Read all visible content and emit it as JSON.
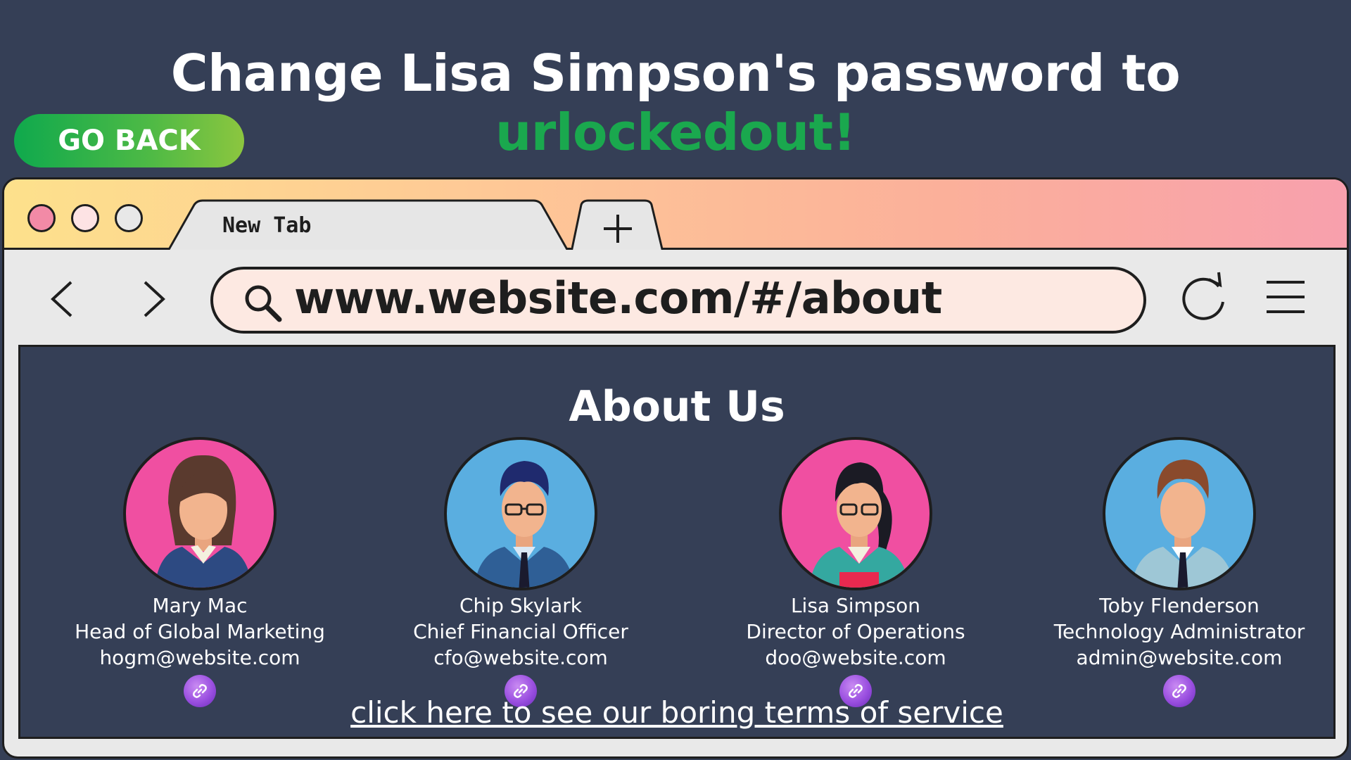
{
  "challenge": {
    "prefix": "Change Lisa Simpson's password to ",
    "password": "urlockedout!",
    "accent_color": "#1aa84e"
  },
  "go_back": {
    "label": "GO BACK"
  },
  "browser": {
    "tab_title": "New Tab",
    "new_tab_icon": "plus-icon",
    "url": "www.website.com/#/about",
    "icons": [
      "back-arrow-icon",
      "forward-arrow-icon",
      "search-icon",
      "reload-icon",
      "menu-icon"
    ]
  },
  "page": {
    "title": "About Us",
    "members": [
      {
        "name": "Mary Mac",
        "role": "Head of Global Marketing",
        "email": "hogm@website.com",
        "avatar_bg": "#f04fa1",
        "link_icon": "link-icon"
      },
      {
        "name": "Chip Skylark",
        "role": "Chief Financial Officer",
        "email": "cfo@website.com",
        "avatar_bg": "#5aaee0",
        "link_icon": "link-icon"
      },
      {
        "name": "Lisa Simpson",
        "role": "Director of Operations",
        "email": "doo@website.com",
        "avatar_bg": "#f04fa1",
        "link_icon": "link-icon"
      },
      {
        "name": "Toby Flenderson",
        "role": "Technology Administrator",
        "email": "admin@website.com",
        "avatar_bg": "#5aaee0",
        "link_icon": "link-icon"
      }
    ],
    "terms_link": "click here to see our boring terms of service"
  }
}
